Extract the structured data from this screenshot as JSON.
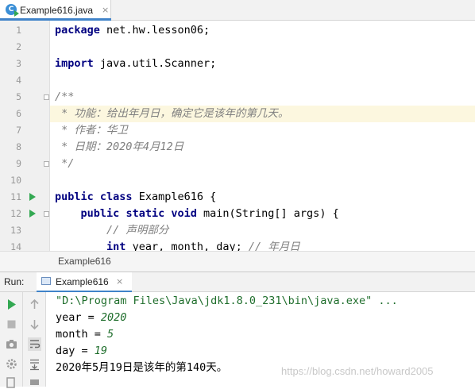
{
  "editor_tab": {
    "filename": "Example616.java",
    "close": "×"
  },
  "code_lines": [
    {
      "num": "1",
      "parts": [
        [
          "kw",
          "package"
        ],
        [
          "",
          "net.hw.lesson06;"
        ]
      ]
    },
    {
      "num": "2",
      "parts": []
    },
    {
      "num": "3",
      "parts": [
        [
          "kw",
          "import"
        ],
        [
          "",
          "java.util.Scanner;"
        ]
      ]
    },
    {
      "num": "4",
      "parts": []
    },
    {
      "num": "5",
      "parts": [
        [
          "cm",
          "/**"
        ]
      ]
    },
    {
      "num": "6",
      "parts": [
        [
          "cm",
          " * 功能：给出年月日，确定它是该年的第几天。"
        ]
      ],
      "highlight": true
    },
    {
      "num": "7",
      "parts": [
        [
          "cm",
          " * 作者：华卫"
        ]
      ]
    },
    {
      "num": "8",
      "parts": [
        [
          "cm",
          " * 日期：2020年4月12日"
        ]
      ]
    },
    {
      "num": "9",
      "parts": [
        [
          "cm",
          " */"
        ]
      ]
    },
    {
      "num": "10",
      "parts": []
    },
    {
      "num": "11",
      "parts": [
        [
          "kw",
          "public"
        ],
        [
          "kw",
          "class"
        ],
        [
          "",
          "Example616 {"
        ]
      ],
      "run": true
    },
    {
      "num": "12",
      "parts": [
        [
          "",
          "    "
        ],
        [
          "kw",
          "public"
        ],
        [
          "kw",
          "static"
        ],
        [
          "kw",
          "void"
        ],
        [
          "",
          "main(String[] args) {"
        ]
      ],
      "run": true
    },
    {
      "num": "13",
      "parts": [
        [
          "cm",
          "        // 声明部分"
        ]
      ]
    },
    {
      "num": "14",
      "parts": [
        [
          "",
          "        "
        ],
        [
          "kw",
          "int"
        ],
        [
          "",
          "year, month, day; "
        ],
        [
          "cm",
          "// 年月日"
        ]
      ]
    }
  ],
  "breadcrumb": "Example616",
  "run_panel": {
    "label": "Run:",
    "tab_label": "Example616",
    "close": "×"
  },
  "console": {
    "command": "\"D:\\Program Files\\Java\\jdk1.8.0_231\\bin\\java.exe\" ...",
    "lines": [
      {
        "prefix": "year = ",
        "value": "2020"
      },
      {
        "prefix": "month = ",
        "value": "5"
      },
      {
        "prefix": "day = ",
        "value": "19"
      }
    ],
    "result": "2020年5月19日是该年的第140天。"
  },
  "watermark": "https://blog.csdn.net/howard2005",
  "colors": {
    "keyword": "#000080",
    "comment": "#808080",
    "highlight_line": "#fcf7df",
    "run_green": "#33a852",
    "console_value": "#1f6e2c"
  }
}
